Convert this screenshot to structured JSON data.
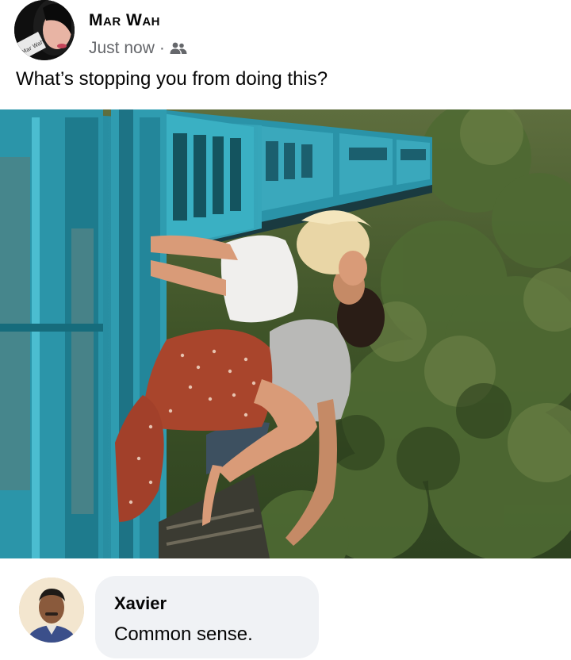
{
  "post": {
    "author_name": "Mar Wah",
    "timestamp": "Just now",
    "separator": "·",
    "audience_icon": "friends-icon",
    "text": "What’s stopping you from doing this?",
    "avatar_logo_text": "Mar Wah",
    "photo": "couple-kissing-hanging-off-blue-train-over-forest"
  },
  "comment": {
    "author_name": "Xavier",
    "text": "Common sense."
  },
  "colors": {
    "name_text": "#050505",
    "meta_text": "#65676b",
    "bubble_bg": "#f0f2f5",
    "train_blue": "#2a93a8"
  }
}
